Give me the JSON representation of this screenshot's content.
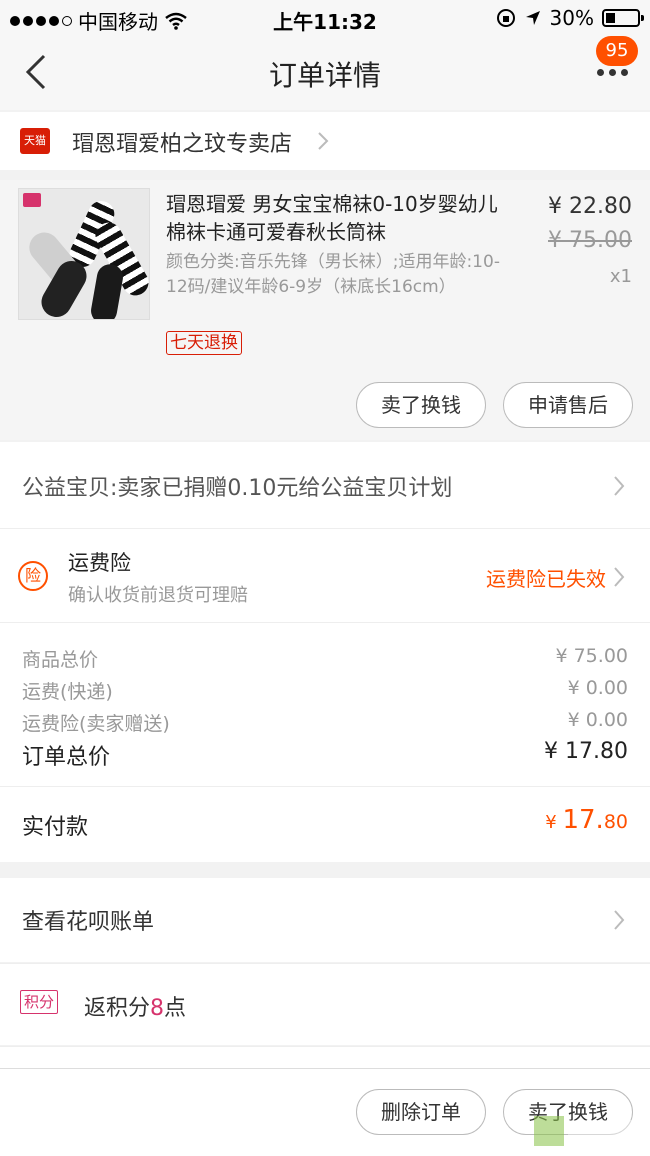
{
  "status": {
    "carrier": "中国移动",
    "time": "上午11:32",
    "battery": "30%",
    "battery_level": 0.3
  },
  "nav": {
    "title": "订单详情",
    "badge": "95"
  },
  "store": {
    "name": "瑁恩瑁爱柏之玟专卖店",
    "tmall_label": "天猫"
  },
  "item": {
    "title": "瑁恩瑁爱 男女宝宝棉袜0-10岁婴幼儿棉袜卡通可爱春秋长筒袜",
    "sku": "颜色分类:音乐先锋（男长袜）;适用年龄:10-12码/建议年龄6-9岁（袜底长16cm）",
    "tag": "七天退换",
    "price": "¥ 22.80",
    "original_price": "¥ 75.00",
    "qty": "x1",
    "btn_sell": "卖了换钱",
    "btn_after_sale": "申请售后"
  },
  "charity": {
    "label": "公益宝贝:卖家已捐赠0.10元给公益宝贝计划"
  },
  "insurance": {
    "icon_char": "险",
    "title": "运费险",
    "subtitle": "确认收货前退货可理赔",
    "status": "运费险已失效"
  },
  "totals": {
    "goods_label": "商品总价",
    "goods_value": "¥ 75.00",
    "shipping_label": "运费(快递)",
    "shipping_value": "¥ 0.00",
    "ins_label": "运费险(卖家赠送)",
    "ins_value": "¥ 0.00",
    "order_label": "订单总价",
    "order_value": "¥ 17.80"
  },
  "paid": {
    "label": "实付款",
    "currency": "¥ ",
    "int": "17.",
    "dec": "80"
  },
  "huabei": {
    "label": "查看花呗账单"
  },
  "points": {
    "tag": "积分",
    "prefix": "返积分",
    "num": "8",
    "suffix": "点"
  },
  "bottom": {
    "delete_label": "删除订单",
    "sell_label": "卖了换钱"
  },
  "colors": {
    "accent": "#ff5000",
    "tmall": "#d81e06",
    "points": "#d6336c"
  }
}
